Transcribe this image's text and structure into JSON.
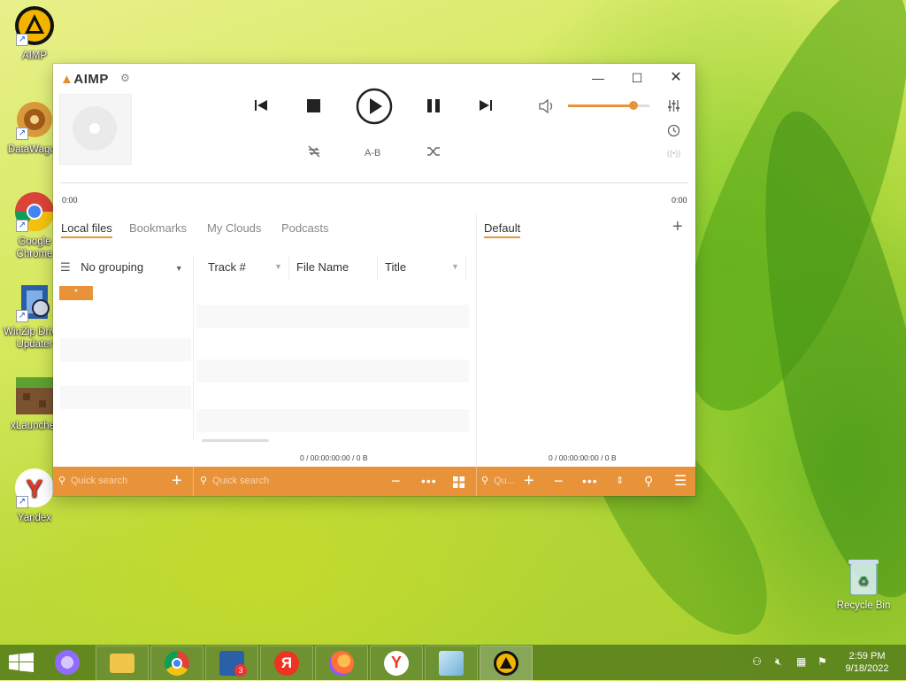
{
  "desktop": {
    "icons": [
      {
        "label": "AIMP"
      },
      {
        "label": "DataWagon"
      },
      {
        "label": "Google Chrome"
      },
      {
        "label": "WinZip Driver Updater"
      },
      {
        "label": "xLauncher"
      },
      {
        "label": "Yandex"
      }
    ],
    "recycle_bin": "Recycle Bin"
  },
  "aimp": {
    "logo": "AIMP",
    "controls": {
      "ab_label": "A-B",
      "volume_level": 0.8
    },
    "time_left": "0:00",
    "time_right": "0:00",
    "left_tabs": [
      "Local files",
      "Bookmarks",
      "My Clouds",
      "Podcasts"
    ],
    "right_tab": "Default",
    "grouping": "No grouping",
    "columns": [
      "Track #",
      "File Name",
      "Title"
    ],
    "badge": "*",
    "status_left": "0 / 00:00:00:00 / 0 B",
    "status_right": "0 / 00:00:00:00 / 0 B",
    "bottom": {
      "search1": "Quick search",
      "search2": "Quick search",
      "search3": "Qu..."
    }
  },
  "taskbar": {
    "time": "2:59 PM",
    "date": "9/18/2022"
  }
}
